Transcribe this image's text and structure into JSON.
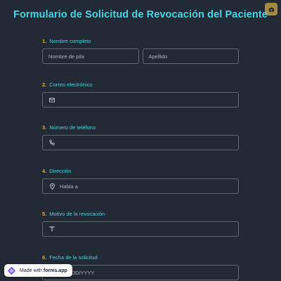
{
  "form": {
    "title": "Formulario de Solicitud de Revocación del Paciente"
  },
  "questions": [
    {
      "number": "1.",
      "label": "Nombre completo",
      "first_placeholder": "Nombre de pila",
      "last_placeholder": "Apellido"
    },
    {
      "number": "2.",
      "label": "Correo electrónico",
      "icon": "envelope-icon",
      "placeholder": ""
    },
    {
      "number": "3.",
      "label": "Número de teléfono",
      "icon": "phone-icon",
      "placeholder": ""
    },
    {
      "number": "4.",
      "label": "Dirección",
      "icon": "location-pin-icon",
      "placeholder": "Habla a"
    },
    {
      "number": "5.",
      "label": "Motivo de la revocación",
      "icon": "text-icon",
      "placeholder": ""
    },
    {
      "number": "6.",
      "label": "Fecha de la solicitud",
      "placeholder": "MM/DD/YYYY"
    }
  ],
  "badge": {
    "prefix": "Made with",
    "brand": "forms.app"
  },
  "colors": {
    "background": "#222a36",
    "accent": "#48d6e6",
    "number": "#f0a830",
    "badge_button": "#a48b45"
  }
}
